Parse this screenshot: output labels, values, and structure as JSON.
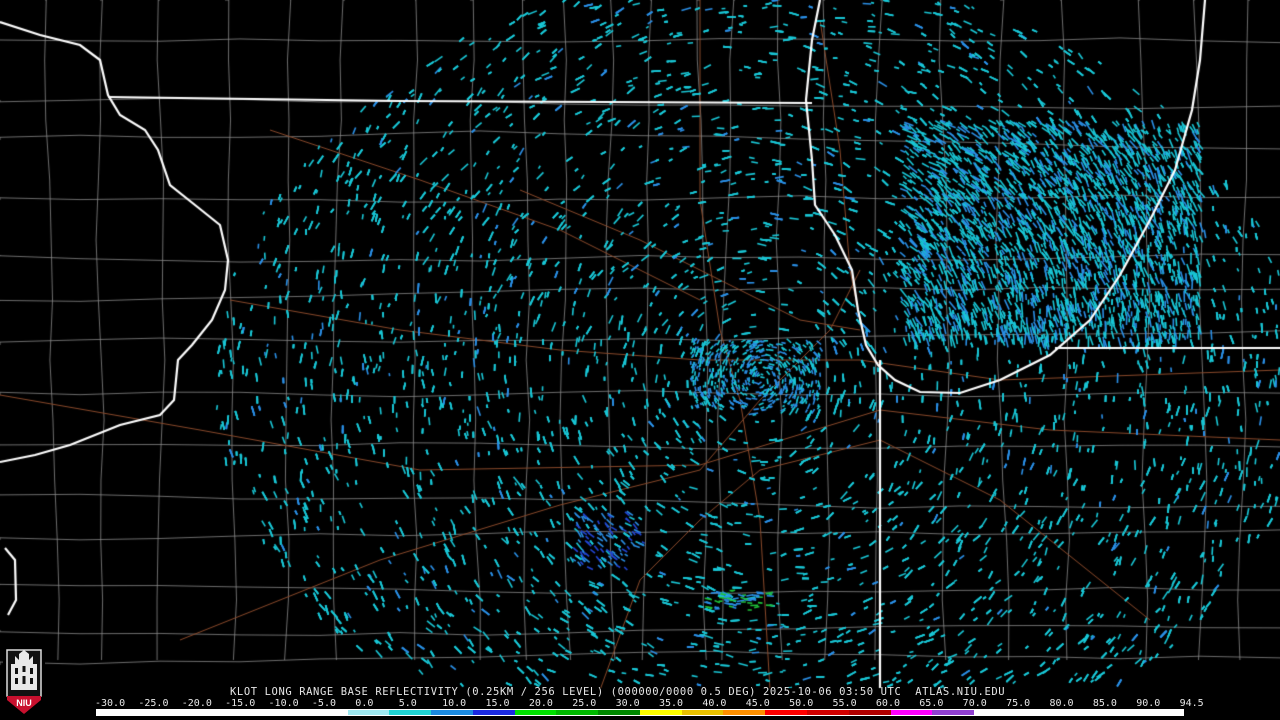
{
  "product": {
    "title": "KLOT LONG RANGE BASE REFLECTIVITY (0.25KM / 256 LEVEL) (000000/0000 0.5 DEG) 2025-10-06 03:50 UTC  ATLAS.NIU.EDU"
  },
  "logo": {
    "text": "NIU",
    "icon": "niu-tower-icon"
  },
  "colorbar": {
    "labels": [
      "-30.0",
      "-25.0",
      "-20.0",
      "-15.0",
      "-10.0",
      "-5.0",
      "0.0",
      "5.0",
      "10.0",
      "15.0",
      "20.0",
      "25.0",
      "30.0",
      "35.0",
      "40.0",
      "45.0",
      "50.0",
      "55.0",
      "60.0",
      "65.0",
      "70.0",
      "75.0",
      "80.0",
      "85.0",
      "90.0",
      "94.5"
    ],
    "colors": [
      "#ffffff",
      "#ffffff",
      "#ffffff",
      "#ffffff",
      "#ffffff",
      "#ffffff",
      "#9ee8f0",
      "#1fd4d4",
      "#1a8ae0",
      "#1a2ae0",
      "#00e000",
      "#00b800",
      "#008800",
      "#ffff00",
      "#e8c000",
      "#ff9000",
      "#ff0000",
      "#d00000",
      "#b00000",
      "#ff00ff",
      "#9040d0",
      "#ffffff",
      "#ffffff",
      "#ffffff",
      "#ffffff",
      "#ffffff"
    ]
  },
  "map_colors": {
    "state_border": "#ffffff",
    "county_line": "#8a8a8a",
    "highway": "#8b4a2b",
    "echo_light": "#19c7d6",
    "echo_mid": "#2a8fe6",
    "echo_strong": "#2246d8",
    "echo_green": "#1fc43a"
  }
}
